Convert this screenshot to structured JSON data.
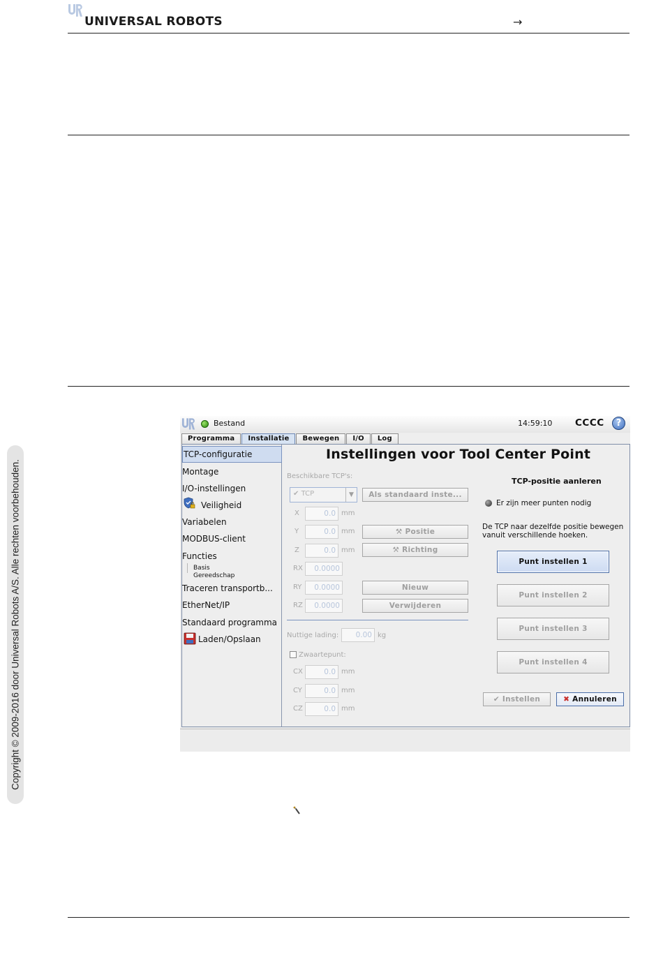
{
  "header": {
    "brand": "UNIVERSAL ROBOTS",
    "arrow": "→"
  },
  "sidebar_copyright": "Copyright © 2009-2016 door Universal Robots A/S. Alle rechten voorbehouden.",
  "screenshot": {
    "topbar": {
      "file_menu": "Bestand",
      "time": "14:59:10",
      "robot_name": "CCCC",
      "help": "?"
    },
    "tabs": [
      {
        "label": "Programma",
        "active": false
      },
      {
        "label": "Installatie",
        "active": true
      },
      {
        "label": "Bewegen",
        "active": false
      },
      {
        "label": "I/O",
        "active": false
      },
      {
        "label": "Log",
        "active": false
      }
    ],
    "nav": {
      "items": [
        "TCP-configuratie",
        "Montage",
        "I/O-instellingen",
        "Veiligheid",
        "Variabelen",
        "MODBUS-client",
        "Functies",
        "Traceren transportb...",
        "EtherNet/IP",
        "Standaard programma",
        "Laden/Opslaan"
      ],
      "sub_items": [
        "Basis",
        "Gereedschap"
      ],
      "selected": "TCP-configuratie"
    },
    "title": "Instellingen voor Tool Center Point",
    "tcp": {
      "available_label": "Beschikbare TCP's:",
      "selected_tcp": "TCP",
      "set_default_button": "Als standaard inste...",
      "fields": [
        {
          "axis": "X",
          "value": "0.0",
          "unit": "mm"
        },
        {
          "axis": "Y",
          "value": "0.0",
          "unit": "mm"
        },
        {
          "axis": "Z",
          "value": "0.0",
          "unit": "mm"
        },
        {
          "axis": "RX",
          "value": "0.0000",
          "unit": ""
        },
        {
          "axis": "RY",
          "value": "0.0000",
          "unit": ""
        },
        {
          "axis": "RZ",
          "value": "0.0000",
          "unit": ""
        }
      ],
      "position_button": "Positie",
      "orientation_button": "Richting",
      "new_button": "Nieuw",
      "delete_button": "Verwijderen",
      "payload_label": "Nuttige lading:",
      "payload_value": "0.00",
      "payload_unit": "kg",
      "cog_label": "Zwaartepunt:",
      "cog_fields": [
        {
          "axis": "CX",
          "value": "0.0",
          "unit": "mm"
        },
        {
          "axis": "CY",
          "value": "0.0",
          "unit": "mm"
        },
        {
          "axis": "CZ",
          "value": "0.0",
          "unit": "mm"
        }
      ]
    },
    "teach": {
      "heading": "TCP-positie aanleren",
      "status": "Er zijn meer punten nodig",
      "instruction_line1": "De TCP naar dezelfde positie bewegen",
      "instruction_line2": "vanuit verschillende hoeken.",
      "point_buttons": [
        "Punt instellen 1",
        "Punt instellen 2",
        "Punt instellen 3",
        "Punt instellen 4"
      ],
      "set_button": "Instellen",
      "cancel_button": "Annuleren"
    }
  }
}
